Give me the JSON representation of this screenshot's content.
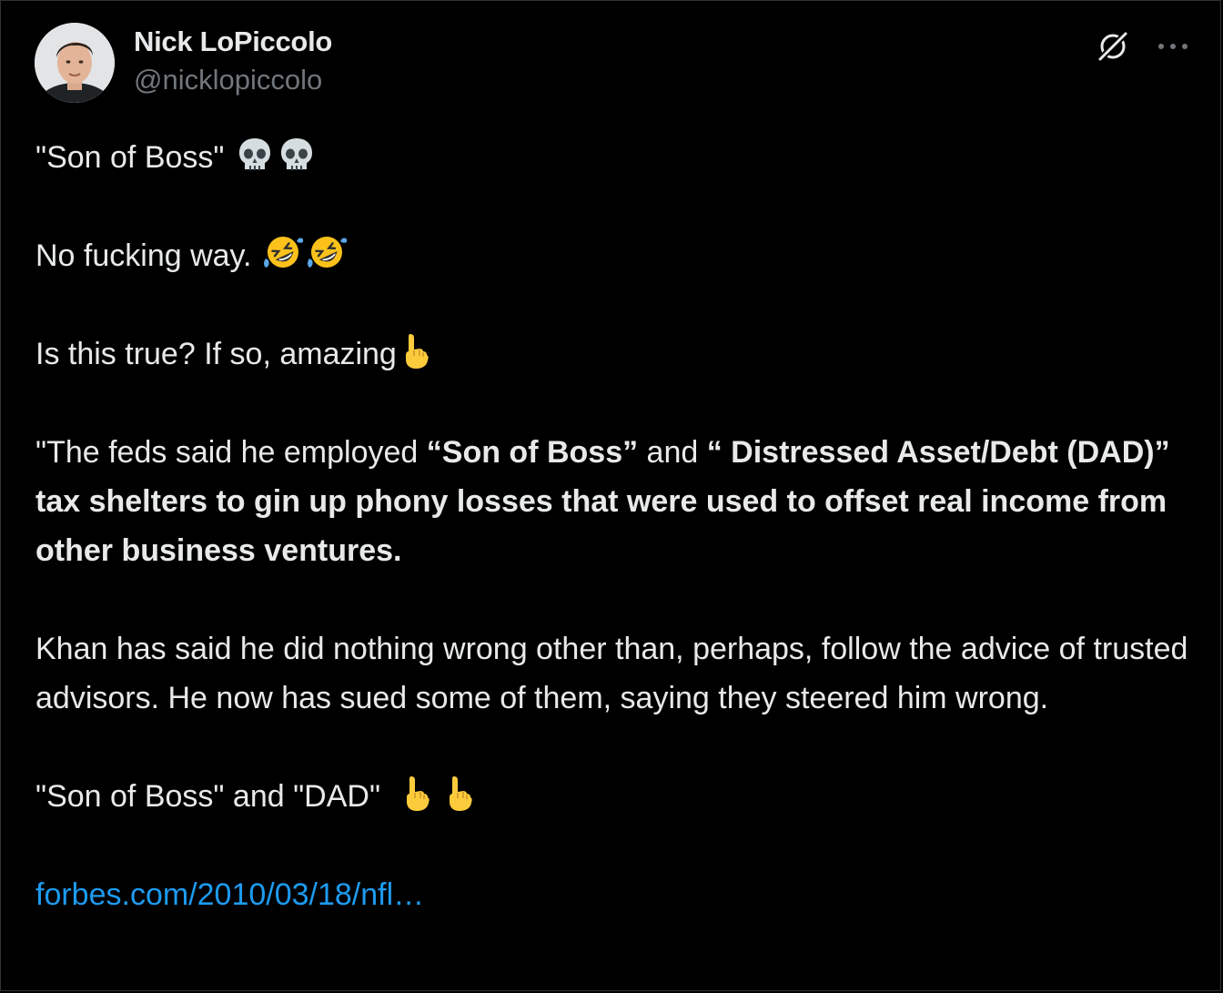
{
  "author": {
    "display_name": "Nick LoPiccolo",
    "handle": "@nicklopiccolo"
  },
  "actions": {
    "grok_icon": "grok-icon",
    "more_icon": "more-icon"
  },
  "tweet": {
    "p1_text": "\"Son of Boss\"",
    "p2_text": "No fucking way.",
    "p3_text": "Is this true? If so, amazing",
    "p4_a": "\"The feds said he employed ",
    "p4_b": "“Son of Boss”",
    "p4_c": " and ",
    "p4_d": "“ Distressed Asset/Debt (DAD)” tax shelters to gin up phony losses that were used to offset real income from other business ventures.",
    "p5_text": "Khan has said he did nothing wrong other than, perhaps, follow the advice of trusted advisors. He now has sued some of them, saying they steered him wrong.",
    "p6_text": "\"Son of Boss\" and \"DAD\"",
    "link_text": "forbes.com/2010/03/18/nfl…"
  },
  "colors": {
    "background": "#000000",
    "text": "#e7e9ea",
    "secondary": "#71767b",
    "link": "#1d9bf0"
  }
}
